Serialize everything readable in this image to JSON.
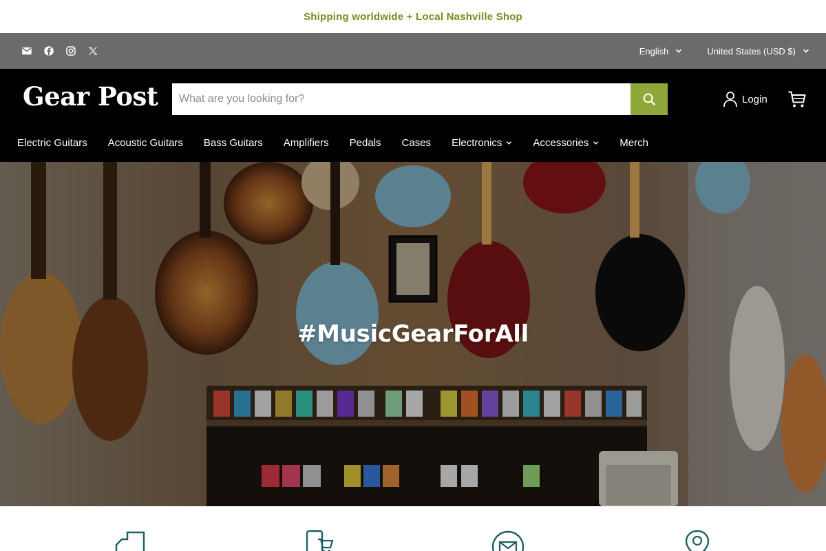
{
  "announcement": {
    "text": "Shipping worldwide + Local Nashville Shop"
  },
  "utility": {
    "social_icons": [
      "email-icon",
      "facebook-icon",
      "instagram-icon",
      "x-icon"
    ],
    "language": "English",
    "currency": "United States (USD $)"
  },
  "header": {
    "logo": "Gear Post",
    "search_placeholder": "What are you looking for?",
    "login_label": "Login",
    "accent_color": "#8fa83a"
  },
  "nav": {
    "items": [
      {
        "label": "Electric Guitars"
      },
      {
        "label": "Acoustic Guitars"
      },
      {
        "label": "Bass Guitars"
      },
      {
        "label": "Amplifiers"
      },
      {
        "label": "Pedals"
      },
      {
        "label": "Cases"
      },
      {
        "label": "Electronics"
      },
      {
        "label": "Accessories"
      },
      {
        "label": "Merch"
      }
    ]
  },
  "hero": {
    "title": "#MusicGearForAll"
  },
  "features": {
    "icons": [
      "shipping-icon",
      "mobile-shop-icon",
      "email-icon",
      "location-pin-icon"
    ]
  }
}
